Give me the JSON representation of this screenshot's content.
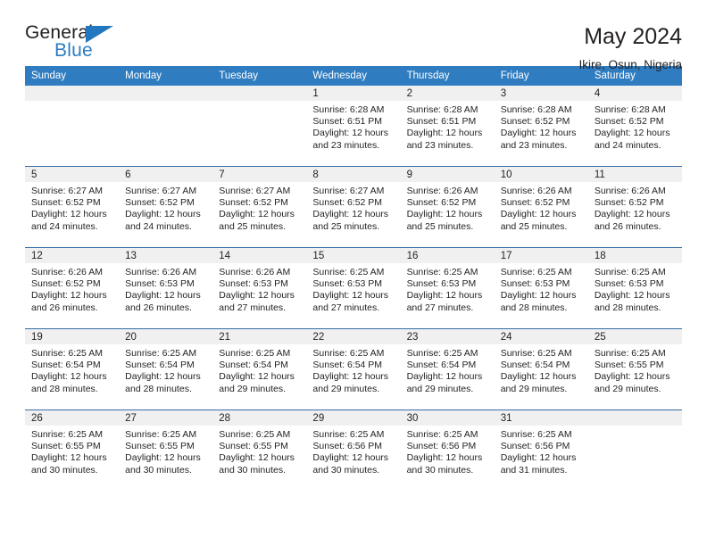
{
  "brand": {
    "name_part1": "General",
    "name_part2": "Blue"
  },
  "header": {
    "title": "May 2024",
    "location": "Ikire, Osun, Nigeria"
  },
  "weekday_headers": [
    "Sunday",
    "Monday",
    "Tuesday",
    "Wednesday",
    "Thursday",
    "Friday",
    "Saturday"
  ],
  "labels": {
    "sunrise_prefix": "Sunrise: ",
    "sunset_prefix": "Sunset: ",
    "daylight_prefix": "Daylight: "
  },
  "colors": {
    "header_blue": "#2f7dc0",
    "brand_blue": "#2277bf",
    "row_divider": "#336ea5",
    "daynum_band": "#f0f0f0"
  },
  "weeks": [
    [
      {
        "day": "",
        "empty": true
      },
      {
        "day": "",
        "empty": true
      },
      {
        "day": "",
        "empty": true
      },
      {
        "day": "1",
        "sunrise": "Sunrise: 6:28 AM",
        "sunset": "Sunset: 6:51 PM",
        "daylight_line1": "Daylight: 12 hours",
        "daylight_line2": "and 23 minutes."
      },
      {
        "day": "2",
        "sunrise": "Sunrise: 6:28 AM",
        "sunset": "Sunset: 6:51 PM",
        "daylight_line1": "Daylight: 12 hours",
        "daylight_line2": "and 23 minutes."
      },
      {
        "day": "3",
        "sunrise": "Sunrise: 6:28 AM",
        "sunset": "Sunset: 6:52 PM",
        "daylight_line1": "Daylight: 12 hours",
        "daylight_line2": "and 23 minutes."
      },
      {
        "day": "4",
        "sunrise": "Sunrise: 6:28 AM",
        "sunset": "Sunset: 6:52 PM",
        "daylight_line1": "Daylight: 12 hours",
        "daylight_line2": "and 24 minutes."
      }
    ],
    [
      {
        "day": "5",
        "sunrise": "Sunrise: 6:27 AM",
        "sunset": "Sunset: 6:52 PM",
        "daylight_line1": "Daylight: 12 hours",
        "daylight_line2": "and 24 minutes."
      },
      {
        "day": "6",
        "sunrise": "Sunrise: 6:27 AM",
        "sunset": "Sunset: 6:52 PM",
        "daylight_line1": "Daylight: 12 hours",
        "daylight_line2": "and 24 minutes."
      },
      {
        "day": "7",
        "sunrise": "Sunrise: 6:27 AM",
        "sunset": "Sunset: 6:52 PM",
        "daylight_line1": "Daylight: 12 hours",
        "daylight_line2": "and 25 minutes."
      },
      {
        "day": "8",
        "sunrise": "Sunrise: 6:27 AM",
        "sunset": "Sunset: 6:52 PM",
        "daylight_line1": "Daylight: 12 hours",
        "daylight_line2": "and 25 minutes."
      },
      {
        "day": "9",
        "sunrise": "Sunrise: 6:26 AM",
        "sunset": "Sunset: 6:52 PM",
        "daylight_line1": "Daylight: 12 hours",
        "daylight_line2": "and 25 minutes."
      },
      {
        "day": "10",
        "sunrise": "Sunrise: 6:26 AM",
        "sunset": "Sunset: 6:52 PM",
        "daylight_line1": "Daylight: 12 hours",
        "daylight_line2": "and 25 minutes."
      },
      {
        "day": "11",
        "sunrise": "Sunrise: 6:26 AM",
        "sunset": "Sunset: 6:52 PM",
        "daylight_line1": "Daylight: 12 hours",
        "daylight_line2": "and 26 minutes."
      }
    ],
    [
      {
        "day": "12",
        "sunrise": "Sunrise: 6:26 AM",
        "sunset": "Sunset: 6:52 PM",
        "daylight_line1": "Daylight: 12 hours",
        "daylight_line2": "and 26 minutes."
      },
      {
        "day": "13",
        "sunrise": "Sunrise: 6:26 AM",
        "sunset": "Sunset: 6:53 PM",
        "daylight_line1": "Daylight: 12 hours",
        "daylight_line2": "and 26 minutes."
      },
      {
        "day": "14",
        "sunrise": "Sunrise: 6:26 AM",
        "sunset": "Sunset: 6:53 PM",
        "daylight_line1": "Daylight: 12 hours",
        "daylight_line2": "and 27 minutes."
      },
      {
        "day": "15",
        "sunrise": "Sunrise: 6:25 AM",
        "sunset": "Sunset: 6:53 PM",
        "daylight_line1": "Daylight: 12 hours",
        "daylight_line2": "and 27 minutes."
      },
      {
        "day": "16",
        "sunrise": "Sunrise: 6:25 AM",
        "sunset": "Sunset: 6:53 PM",
        "daylight_line1": "Daylight: 12 hours",
        "daylight_line2": "and 27 minutes."
      },
      {
        "day": "17",
        "sunrise": "Sunrise: 6:25 AM",
        "sunset": "Sunset: 6:53 PM",
        "daylight_line1": "Daylight: 12 hours",
        "daylight_line2": "and 28 minutes."
      },
      {
        "day": "18",
        "sunrise": "Sunrise: 6:25 AM",
        "sunset": "Sunset: 6:53 PM",
        "daylight_line1": "Daylight: 12 hours",
        "daylight_line2": "and 28 minutes."
      }
    ],
    [
      {
        "day": "19",
        "sunrise": "Sunrise: 6:25 AM",
        "sunset": "Sunset: 6:54 PM",
        "daylight_line1": "Daylight: 12 hours",
        "daylight_line2": "and 28 minutes."
      },
      {
        "day": "20",
        "sunrise": "Sunrise: 6:25 AM",
        "sunset": "Sunset: 6:54 PM",
        "daylight_line1": "Daylight: 12 hours",
        "daylight_line2": "and 28 minutes."
      },
      {
        "day": "21",
        "sunrise": "Sunrise: 6:25 AM",
        "sunset": "Sunset: 6:54 PM",
        "daylight_line1": "Daylight: 12 hours",
        "daylight_line2": "and 29 minutes."
      },
      {
        "day": "22",
        "sunrise": "Sunrise: 6:25 AM",
        "sunset": "Sunset: 6:54 PM",
        "daylight_line1": "Daylight: 12 hours",
        "daylight_line2": "and 29 minutes."
      },
      {
        "day": "23",
        "sunrise": "Sunrise: 6:25 AM",
        "sunset": "Sunset: 6:54 PM",
        "daylight_line1": "Daylight: 12 hours",
        "daylight_line2": "and 29 minutes."
      },
      {
        "day": "24",
        "sunrise": "Sunrise: 6:25 AM",
        "sunset": "Sunset: 6:54 PM",
        "daylight_line1": "Daylight: 12 hours",
        "daylight_line2": "and 29 minutes."
      },
      {
        "day": "25",
        "sunrise": "Sunrise: 6:25 AM",
        "sunset": "Sunset: 6:55 PM",
        "daylight_line1": "Daylight: 12 hours",
        "daylight_line2": "and 29 minutes."
      }
    ],
    [
      {
        "day": "26",
        "sunrise": "Sunrise: 6:25 AM",
        "sunset": "Sunset: 6:55 PM",
        "daylight_line1": "Daylight: 12 hours",
        "daylight_line2": "and 30 minutes."
      },
      {
        "day": "27",
        "sunrise": "Sunrise: 6:25 AM",
        "sunset": "Sunset: 6:55 PM",
        "daylight_line1": "Daylight: 12 hours",
        "daylight_line2": "and 30 minutes."
      },
      {
        "day": "28",
        "sunrise": "Sunrise: 6:25 AM",
        "sunset": "Sunset: 6:55 PM",
        "daylight_line1": "Daylight: 12 hours",
        "daylight_line2": "and 30 minutes."
      },
      {
        "day": "29",
        "sunrise": "Sunrise: 6:25 AM",
        "sunset": "Sunset: 6:56 PM",
        "daylight_line1": "Daylight: 12 hours",
        "daylight_line2": "and 30 minutes."
      },
      {
        "day": "30",
        "sunrise": "Sunrise: 6:25 AM",
        "sunset": "Sunset: 6:56 PM",
        "daylight_line1": "Daylight: 12 hours",
        "daylight_line2": "and 30 minutes."
      },
      {
        "day": "31",
        "sunrise": "Sunrise: 6:25 AM",
        "sunset": "Sunset: 6:56 PM",
        "daylight_line1": "Daylight: 12 hours",
        "daylight_line2": "and 31 minutes."
      },
      {
        "day": "",
        "empty": true
      }
    ]
  ]
}
